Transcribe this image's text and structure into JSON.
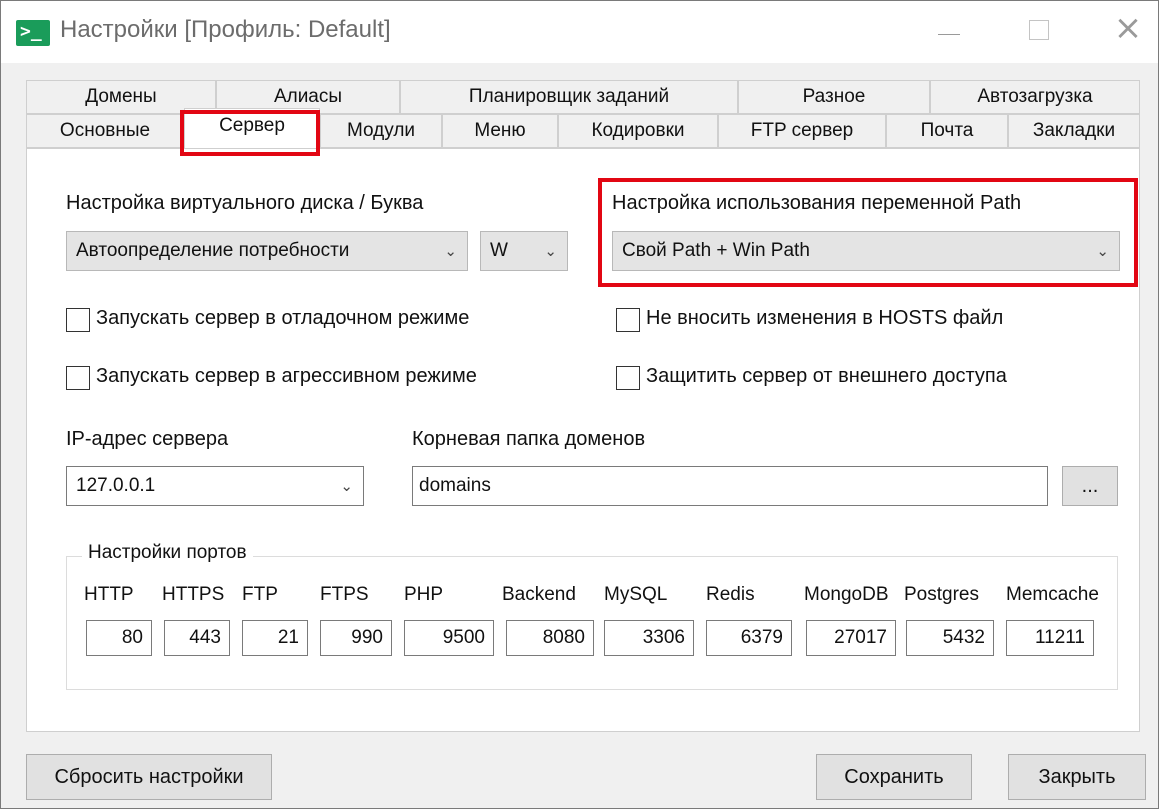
{
  "window": {
    "title": "Настройки [Профиль: Default]",
    "app_icon": "terminal-icon",
    "controls": {
      "minimize": "minimize-icon",
      "maximize": "maximize-icon",
      "close": "×"
    }
  },
  "tabs": {
    "row1": [
      "Домены",
      "Алиасы",
      "Планировщик заданий",
      "Разное",
      "Автозагрузка"
    ],
    "row2": [
      "Основные",
      "Сервер",
      "Модули",
      "Меню",
      "Кодировки",
      "FTP сервер",
      "Почта",
      "Закладки"
    ],
    "active": "Сервер"
  },
  "server": {
    "vdisk_label": "Настройка виртуального диска / Буква",
    "vdisk_value": "Автоопределение потребности",
    "vdisk_letter": "W",
    "path_label": "Настройка использования переменной Path",
    "path_value": "Свой Path + Win Path",
    "checkboxes": {
      "debug": {
        "label": "Запускать сервер в отладочном режиме",
        "checked": false
      },
      "hosts": {
        "label": "Не вносить изменения в HOSTS файл",
        "checked": false
      },
      "aggressive": {
        "label": "Запускать сервер в агрессивном режиме",
        "checked": false
      },
      "protect": {
        "label": "Защитить сервер от внешнего доступа",
        "checked": false
      }
    },
    "ip_label": "IP-адрес сервера",
    "ip_value": "127.0.0.1",
    "root_label": "Корневая папка доменов",
    "root_value": "domains",
    "browse_label": "..."
  },
  "ports": {
    "title": "Настройки портов",
    "items": [
      {
        "label": "HTTP",
        "value": "80"
      },
      {
        "label": "HTTPS",
        "value": "443"
      },
      {
        "label": "FTP",
        "value": "21"
      },
      {
        "label": "FTPS",
        "value": "990"
      },
      {
        "label": "PHP",
        "value": "9500"
      },
      {
        "label": "Backend",
        "value": "8080"
      },
      {
        "label": "MySQL",
        "value": "3306"
      },
      {
        "label": "Redis",
        "value": "6379"
      },
      {
        "label": "MongoDB",
        "value": "27017"
      },
      {
        "label": "Postgres",
        "value": "5432"
      },
      {
        "label": "Memcache",
        "value": "11211"
      }
    ]
  },
  "footer": {
    "reset_label": "Сбросить настройки",
    "save_label": "Сохранить",
    "close_label": "Закрыть"
  },
  "colors": {
    "highlight": "#e20613",
    "app_icon": "#1a9c5a"
  }
}
